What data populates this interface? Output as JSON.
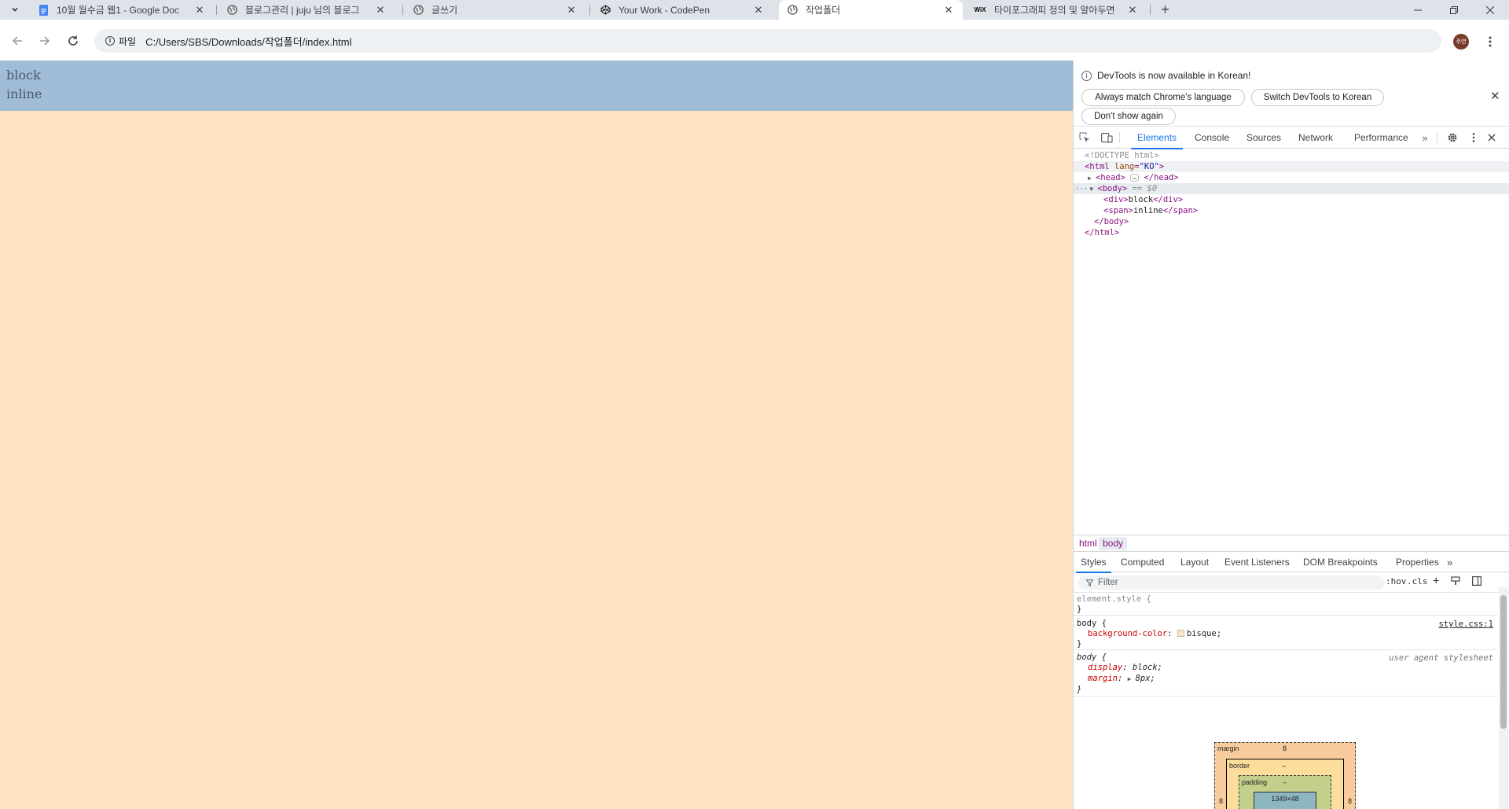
{
  "browser": {
    "tabs": [
      {
        "title": "10월 월수금 웹1 - Google Doc",
        "favicon": "google-docs-icon",
        "active": false
      },
      {
        "title": "블로그관리 | juju 님의 블로그",
        "favicon": "globe-icon",
        "active": false
      },
      {
        "title": "글쓰기",
        "favicon": "globe-icon",
        "active": false
      },
      {
        "title": "Your Work - CodePen",
        "favicon": "codepen-icon",
        "active": false
      },
      {
        "title": "작업폴더",
        "favicon": "globe-icon",
        "active": true
      },
      {
        "title": "타이포그래피 정의 및 알아두면",
        "favicon": "wix-icon",
        "active": false
      }
    ],
    "wix_label": "WiX",
    "site_chip": "파일",
    "url": "C:/Users/SBS/Downloads/작업폴더/index.html",
    "avatar_text": "주연"
  },
  "page": {
    "lines": [
      "block",
      "inline"
    ],
    "background": "#ffe4c4",
    "highlight": "#a0bcd7"
  },
  "devtools": {
    "infobar": {
      "message": "DevTools is now available in Korean!",
      "btn_match": "Always match Chrome's language",
      "btn_switch": "Switch DevTools to Korean",
      "btn_dont_show": "Don't show again"
    },
    "tabs": [
      "Elements",
      "Console",
      "Sources",
      "Network",
      "Performance"
    ],
    "active_tab": "Elements",
    "dom": {
      "doctype": "<!DOCTYPE html>",
      "html_open_tag": "<html ",
      "html_attr": "lang",
      "html_attr_val": "\"KO\"",
      "html_open_end": ">",
      "head_open": "<head>",
      "head_close": "</head>",
      "body_open": "<body>",
      "body_eq": "== $0",
      "div_open": "<div>",
      "div_text": "block",
      "div_close": "</div>",
      "span_open": "<span>",
      "span_text": "inline",
      "span_close": "</span>",
      "body_close": "</body>",
      "html_close": "</html>",
      "ellipsis": "…",
      "dots": "···"
    },
    "breadcrumbs": [
      "html",
      "body"
    ],
    "styles_tabs": [
      "Styles",
      "Computed",
      "Layout",
      "Event Listeners",
      "DOM Breakpoints",
      "Properties"
    ],
    "filter_placeholder": "Filter",
    "hov": ":hov",
    "cls": ".cls",
    "rules": {
      "element_style": "element.style {",
      "close": "}",
      "r1_selector": "body {",
      "r1_source": "style.css:1",
      "r1_prop": "background-color",
      "r1_val": "bisque;",
      "r2_selector": "body {",
      "r2_source": "user agent stylesheet",
      "r2_prop1": "display",
      "r2_val1": "block;",
      "r2_prop2": "margin",
      "r2_val2": "8px;"
    },
    "box_model": {
      "margin_label": "margin",
      "margin_top": "8",
      "margin_left": "8",
      "margin_right": "8",
      "border_label": "border",
      "border_val": "–",
      "padding_label": "padding",
      "padding_val": "–",
      "content": "1349×48"
    }
  }
}
